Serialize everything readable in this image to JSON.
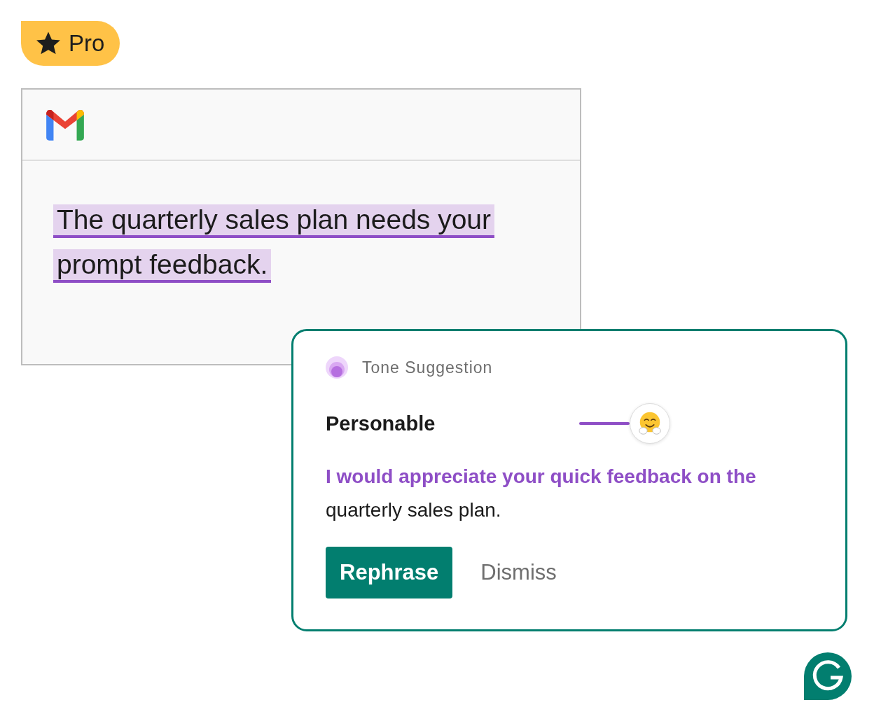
{
  "badge": {
    "label": "Pro"
  },
  "email": {
    "body_lines": [
      "The quarterly sales plan needs your",
      "prompt feedback."
    ]
  },
  "suggestion": {
    "header": "Tone Suggestion",
    "tone": "Personable",
    "text": "**I would appreciate your quick feedback on the** quarterly sales plan.",
    "buttons": [
      {
        "label": "Rephrase",
        "kind": "primary"
      },
      {
        "label": "Dismiss",
        "kind": "plain"
      }
    ]
  }
}
